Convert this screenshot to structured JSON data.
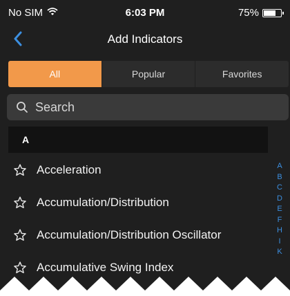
{
  "status_bar": {
    "carrier": "No SIM",
    "time": "6:03 PM",
    "battery_text": "75%",
    "battery_level": 0.75,
    "wifi_icon": "wifi-icon",
    "battery_icon": "battery-icon"
  },
  "nav": {
    "title": "Add Indicators",
    "back_icon": "chevron-left-icon"
  },
  "tabs": [
    {
      "label": "All",
      "active": true
    },
    {
      "label": "Popular",
      "active": false
    },
    {
      "label": "Favorites",
      "active": false
    }
  ],
  "search": {
    "placeholder": "Search",
    "value": "",
    "icon": "search-icon"
  },
  "section": {
    "letter": "A"
  },
  "indicators": [
    {
      "label": "Acceleration",
      "icon": "star-outline-icon"
    },
    {
      "label": "Accumulation/Distribution",
      "icon": "star-outline-icon"
    },
    {
      "label": "Accumulation/Distribution Oscillator",
      "icon": "star-outline-icon"
    },
    {
      "label": "Accumulative Swing Index",
      "icon": "star-outline-icon"
    }
  ],
  "index_letters": [
    "A",
    "B",
    "C",
    "D",
    "E",
    "F",
    "H",
    "I",
    "K"
  ],
  "colors": {
    "accent": "#f2994a",
    "index": "#3c8fe0",
    "background": "#1f1f1f"
  }
}
